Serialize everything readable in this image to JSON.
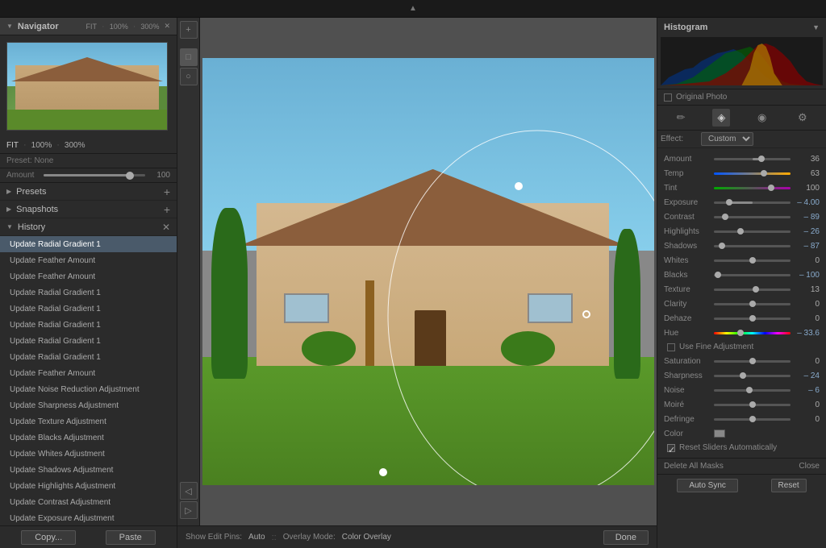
{
  "topbar": {
    "arrow": "▲"
  },
  "left_panel": {
    "navigator_title": "Navigator",
    "fit_label": "FIT",
    "zoom_100": "100%",
    "zoom_300": "300%",
    "close_x": "✕",
    "preset_label": "Preset:",
    "preset_value": "None",
    "amount_label": "Amount",
    "amount_value": "100",
    "sections": {
      "presets_label": "Presets",
      "snapshots_label": "Snapshots",
      "history_label": "History"
    },
    "history_items": [
      "Update Radial Gradient 1",
      "Update Feather Amount",
      "Update Feather Amount",
      "Update Radial Gradient 1",
      "Update Radial Gradient 1",
      "Update Radial Gradient 1",
      "Update Radial Gradient 1",
      "Update Radial Gradient 1",
      "Update Feather Amount",
      "Update Noise Reduction Adjustment",
      "Update Sharpness Adjustment",
      "Update Texture Adjustment",
      "Update Blacks Adjustment",
      "Update Whites Adjustment",
      "Update Shadows Adjustment",
      "Update Highlights Adjustment",
      "Update Contrast Adjustment",
      "Update Exposure Adjustment"
    ],
    "copy_btn": "Copy...",
    "paste_btn": "Paste"
  },
  "bottom_toolbar": {
    "show_edit_pins_label": "Show Edit Pins:",
    "show_edit_pins_value": "Auto",
    "separator": "::",
    "overlay_mode_label": "Overlay Mode:",
    "overlay_mode_value": "Color Overlay",
    "done_btn": "Done"
  },
  "right_panel": {
    "histogram_title": "Histogram",
    "histogram_arrow": "▼",
    "original_photo_label": "Original Photo",
    "tool_icons": [
      "✏️",
      "🖌️",
      "👁️",
      "⚙️"
    ],
    "effect_label": "Effect:",
    "effect_value": "Custom",
    "sliders": [
      {
        "label": "Amount",
        "value": "36",
        "pct": 62,
        "negative": false
      },
      {
        "label": "Temp",
        "value": "63",
        "pct": 65,
        "negative": false
      },
      {
        "label": "Tint",
        "value": "100",
        "pct": 75,
        "negative": false
      },
      {
        "label": "Exposure",
        "value": "– 4.00",
        "pct": 20,
        "negative": true
      },
      {
        "label": "Contrast",
        "value": "– 89",
        "pct": 15,
        "negative": true
      },
      {
        "label": "Highlights",
        "value": "– 26",
        "pct": 35,
        "negative": true
      },
      {
        "label": "Shadows",
        "value": "– 87",
        "pct": 10,
        "negative": true
      },
      {
        "label": "Whites",
        "value": "0",
        "pct": 50,
        "negative": false
      },
      {
        "label": "Blacks",
        "value": "– 100",
        "pct": 5,
        "negative": true
      },
      {
        "label": "Texture",
        "value": "13",
        "pct": 55,
        "negative": false
      },
      {
        "label": "Clarity",
        "value": "0",
        "pct": 50,
        "negative": false
      },
      {
        "label": "Dehaze",
        "value": "0",
        "pct": 50,
        "negative": false
      },
      {
        "label": "Hue",
        "value": "– 33.6",
        "pct": 35,
        "negative": true,
        "colorful": true
      },
      {
        "label": "Saturation",
        "value": "0",
        "pct": 50,
        "negative": false
      },
      {
        "label": "Sharpness",
        "value": "– 24",
        "pct": 38,
        "negative": true
      },
      {
        "label": "Noise",
        "value": "– 6",
        "pct": 46,
        "negative": true
      },
      {
        "label": "Moiré",
        "value": "0",
        "pct": 50,
        "negative": false
      },
      {
        "label": "Defringe",
        "value": "0",
        "pct": 50,
        "negative": false
      }
    ],
    "fine_adjustment_label": "Use Fine Adjustment",
    "color_label": "Color",
    "reset_sliders_label": "Reset Sliders Automatically",
    "delete_masks_btn": "Delete All Masks",
    "close_btn": "Close",
    "auto_sync_btn": "Auto Sync",
    "reset_btn": "Reset"
  }
}
